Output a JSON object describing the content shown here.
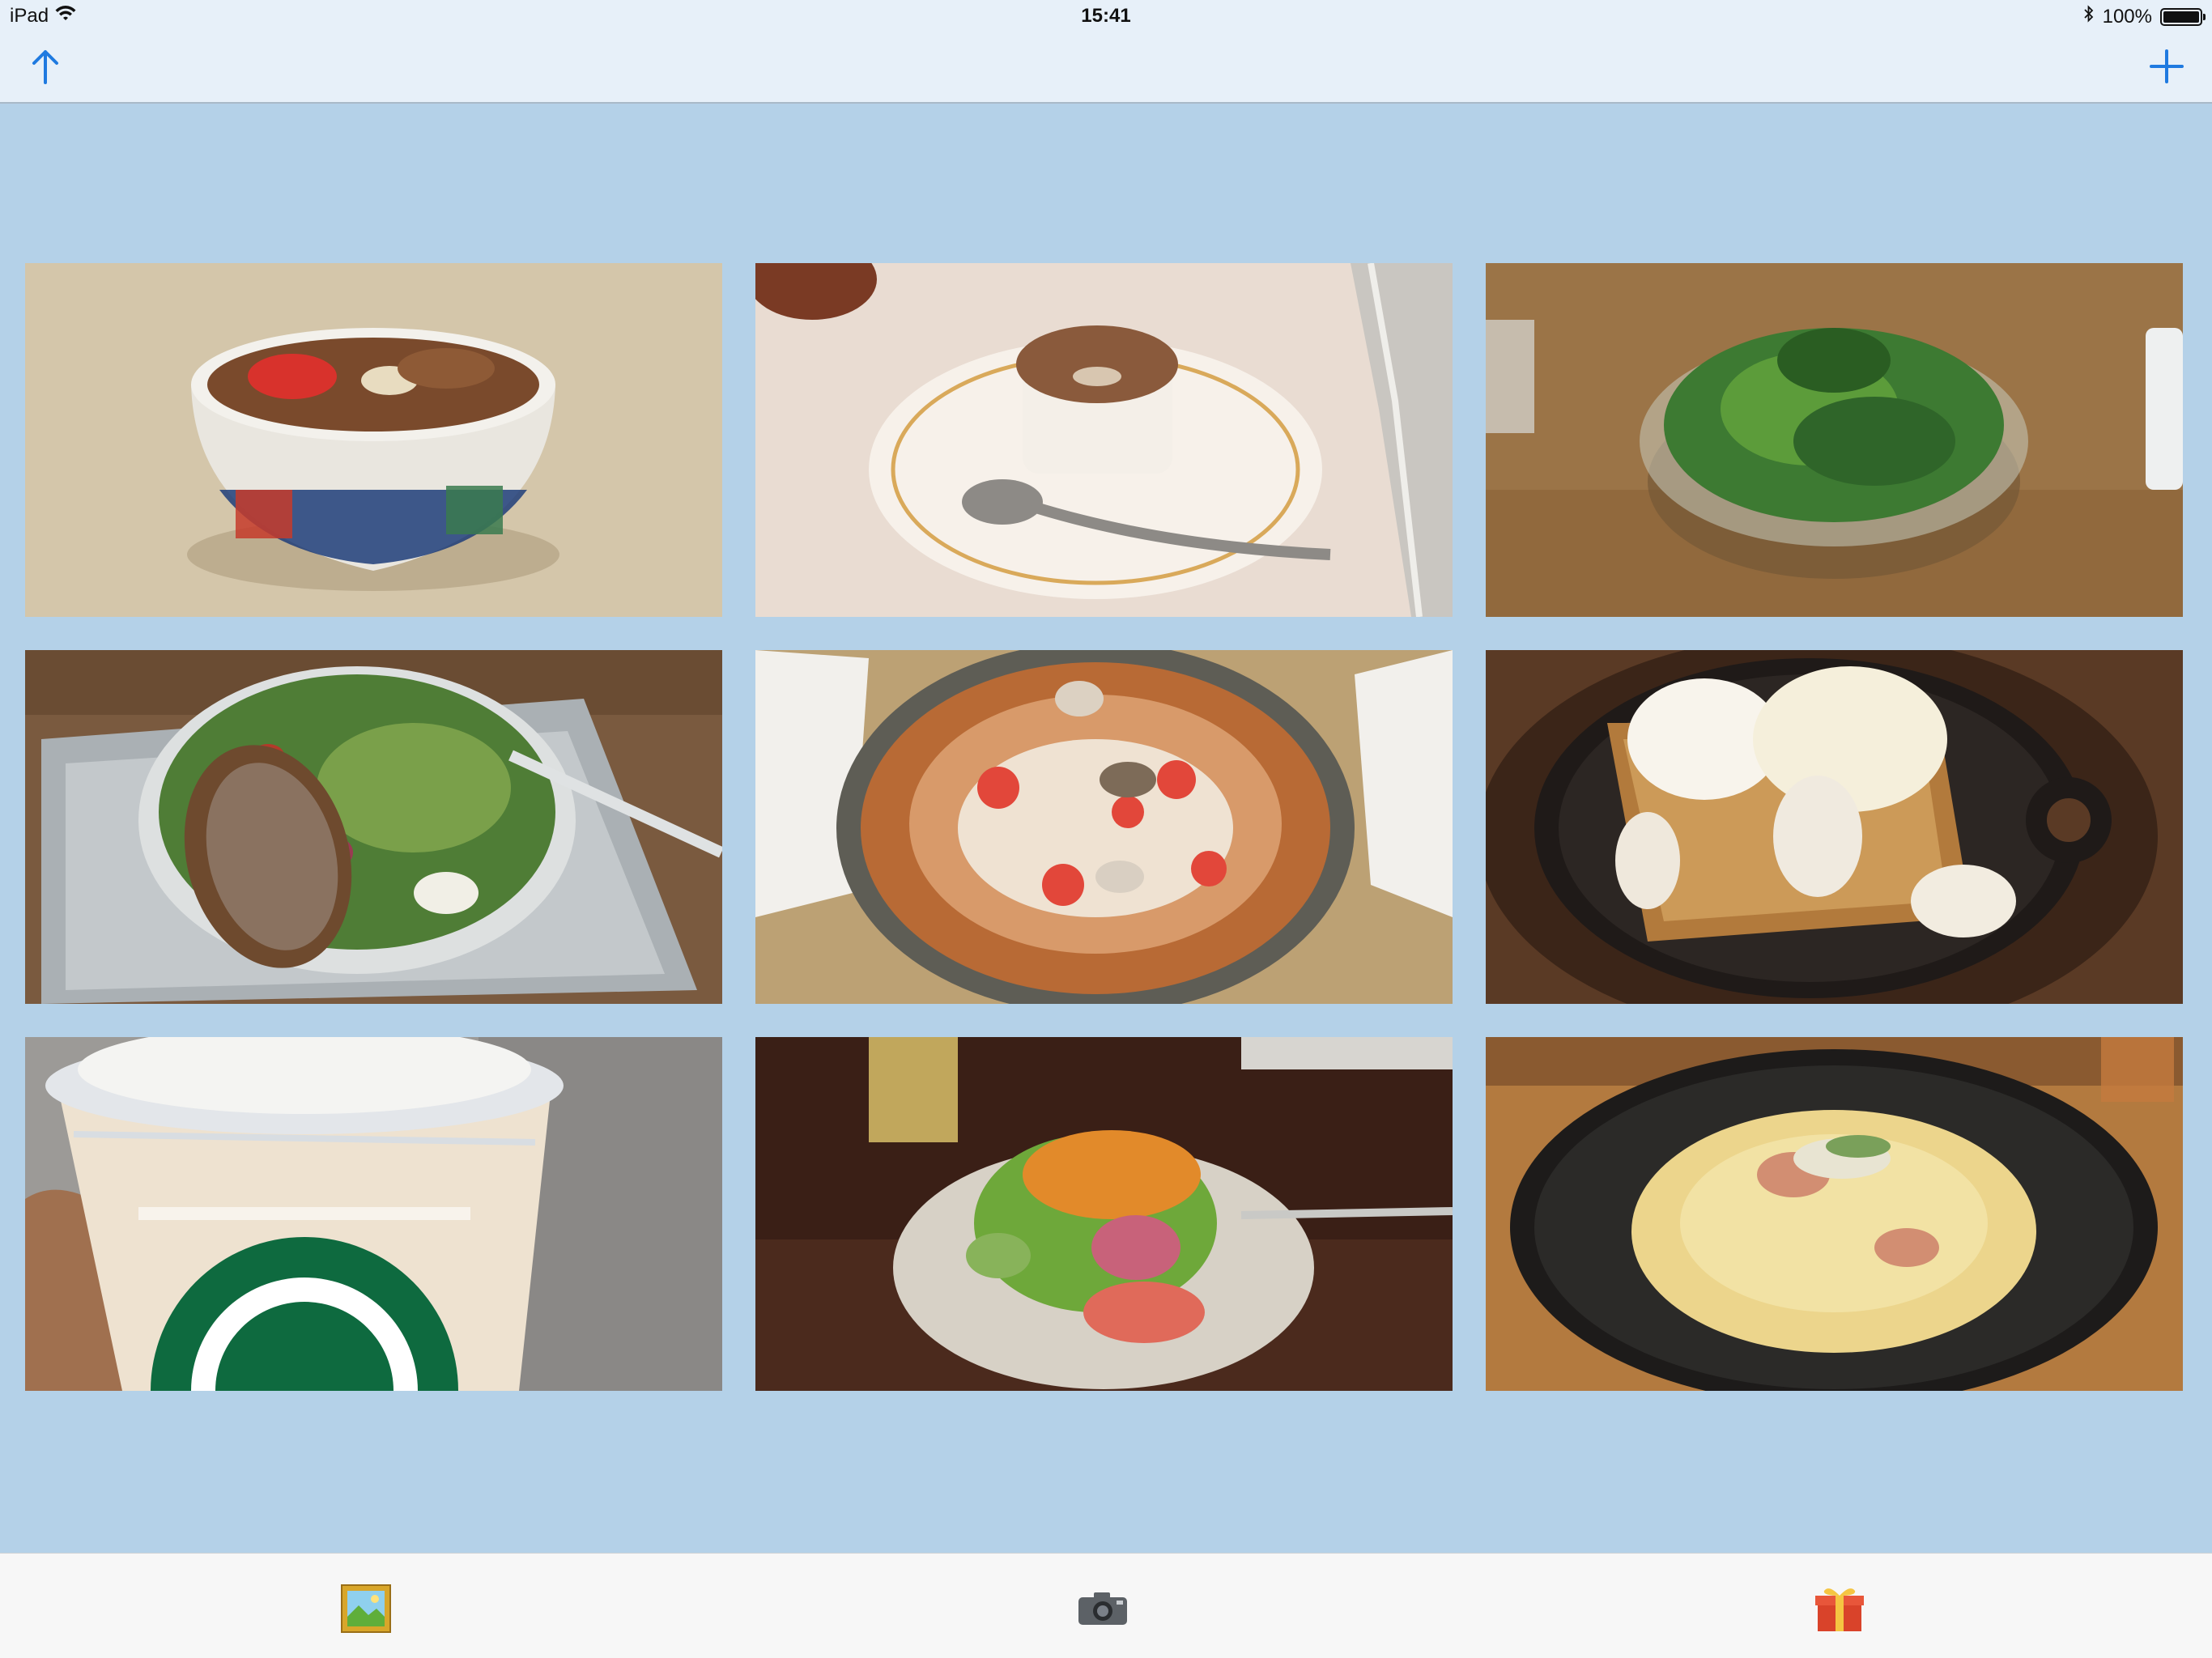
{
  "status_bar": {
    "device": "iPad",
    "time": "15:41",
    "battery": "100%",
    "battery_level": 1.0
  },
  "nav_bar": {
    "left_icon": "up-arrow-icon",
    "right_icon": "plus-icon",
    "tint_color": "#1f7ae0"
  },
  "gallery": {
    "background_color": "#b4d1e8",
    "photos": [
      {
        "name": "photo-beef-bowl",
        "icon": "beef-rice-bowl"
      },
      {
        "name": "photo-souffle",
        "icon": "souffle-dessert"
      },
      {
        "name": "photo-green-salad",
        "icon": "salad-bowl"
      },
      {
        "name": "photo-cobb-salad-bread",
        "icon": "salad-with-bread"
      },
      {
        "name": "photo-seafood-fideua",
        "icon": "seafood-pan"
      },
      {
        "name": "photo-french-toast",
        "icon": "french-toast-skillet"
      },
      {
        "name": "photo-frappuccino",
        "icon": "iced-coffee-cup"
      },
      {
        "name": "photo-side-salad",
        "icon": "salad-plate"
      },
      {
        "name": "photo-pasta",
        "icon": "pasta-bowl"
      }
    ]
  },
  "tab_bar": {
    "tabs": [
      {
        "name": "tab-photos",
        "icon": "framed-picture-icon"
      },
      {
        "name": "tab-camera",
        "icon": "camera-icon"
      },
      {
        "name": "tab-gift",
        "icon": "gift-icon"
      }
    ]
  }
}
